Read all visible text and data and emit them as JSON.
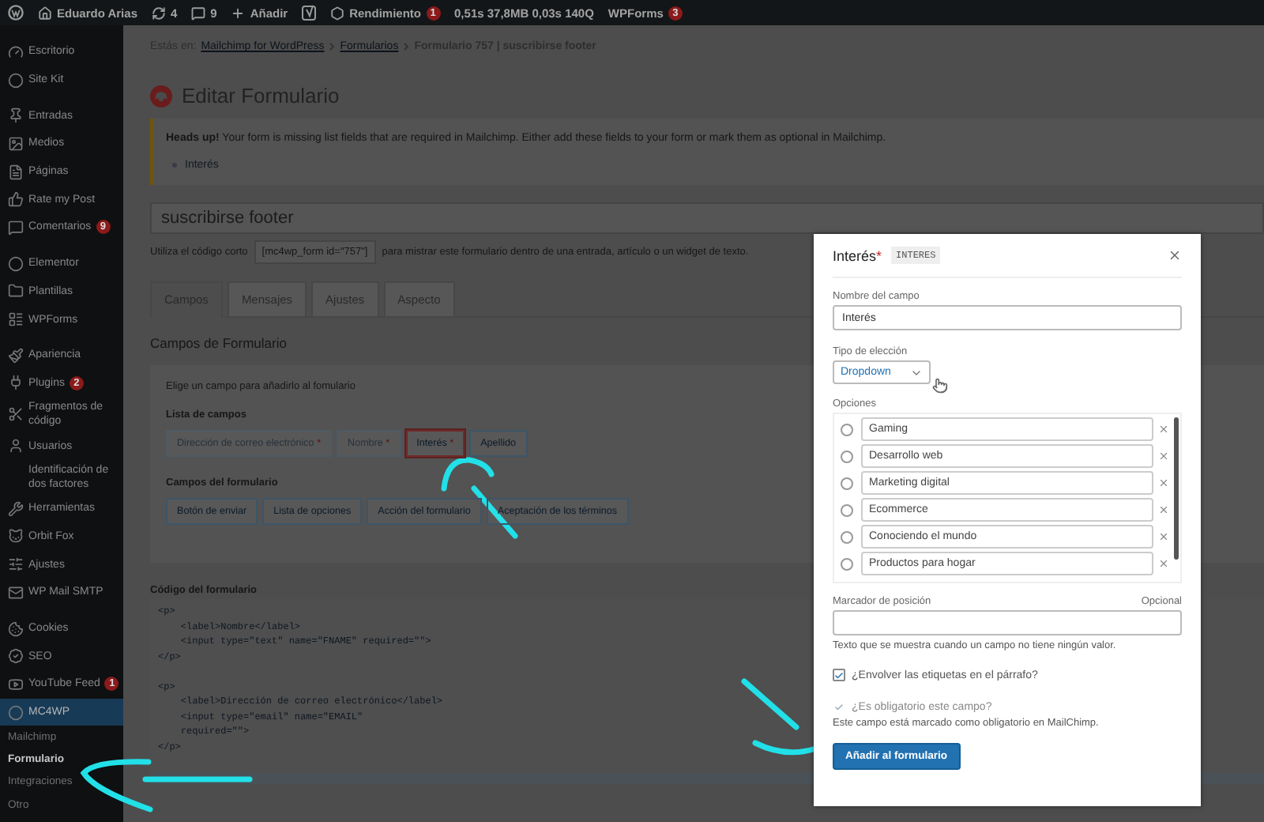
{
  "admin_bar": {
    "items": [
      {
        "kind": "wp"
      },
      {
        "kind": "home",
        "label": "Eduardo Arias"
      },
      {
        "kind": "updates",
        "label": "4"
      },
      {
        "kind": "comments",
        "label": "9"
      },
      {
        "kind": "new",
        "label": "Añadir"
      },
      {
        "kind": "yoast"
      },
      {
        "kind": "performance",
        "label": "Rendimiento",
        "badge": "1"
      },
      {
        "kind": "text",
        "label": "0,51s 37,8MB 0,03s 140Q"
      },
      {
        "kind": "text",
        "label": "WPForms",
        "badge": "3"
      }
    ]
  },
  "sidebar": {
    "groups": [
      {
        "items": [
          {
            "label": "Escritorio",
            "selected": false
          },
          {
            "label": "Site Kit",
            "selected": false
          }
        ]
      },
      {
        "items": [
          {
            "label": "Entradas",
            "selected": false
          },
          {
            "label": "Medios",
            "selected": false
          },
          {
            "label": "Páginas",
            "selected": false
          },
          {
            "label": "Rate my Post",
            "selected": false
          },
          {
            "label": "Comentarios",
            "badge": "9",
            "selected": false
          }
        ]
      },
      {
        "items": [
          {
            "label": "Elementor",
            "selected": false
          },
          {
            "label": "Plantillas",
            "selected": false
          },
          {
            "label": "WPForms",
            "selected": false
          }
        ]
      },
      {
        "items": [
          {
            "label": "Apariencia",
            "selected": false
          },
          {
            "label": "Plugins",
            "badge": "2",
            "selected": false
          },
          {
            "label": "Fragmentos de código",
            "selected": false
          },
          {
            "label": "Usuarios",
            "selected": false
          },
          {
            "label": "Identificación de dos factores",
            "selected": false
          },
          {
            "label": "Herramientas",
            "selected": false
          },
          {
            "label": "Orbit Fox",
            "selected": false
          },
          {
            "label": "Ajustes",
            "selected": false
          },
          {
            "label": "WP Mail SMTP",
            "selected": false
          }
        ]
      },
      {
        "items": [
          {
            "label": "Cookies",
            "selected": false
          },
          {
            "label": "SEO",
            "selected": false
          },
          {
            "label": "YouTube Feed",
            "badge": "1",
            "selected": false
          },
          {
            "label": "MC4WP",
            "selected": true,
            "children": [
              {
                "label": "Mailchimp",
                "selected": false
              },
              {
                "label": "Formulario",
                "selected": true
              },
              {
                "label": "Integraciones",
                "selected": false
              },
              {
                "label": "Otro",
                "selected": false
              }
            ]
          }
        ]
      }
    ]
  },
  "breadcrumb": {
    "prefix": "Estás en:",
    "links": [
      "Mailchimp for WordPress",
      "Formularios"
    ],
    "current": "Formulario 757 | suscribirse footer"
  },
  "page_title": "Editar Formulario",
  "notice": {
    "text": "**Heads up!** Your form is missing list fields that are required in Mailchimp. Either add these fields to your form or mark them as optional in Mailchimp.",
    "items": [
      "Interés"
    ]
  },
  "form_title": "suscribirse footer",
  "shortcode": {
    "before": "Utiliza el código corto",
    "code": "[mc4wp_form id=\"757\"]",
    "after": "para mistrar este formulario dentro de una entrada, artículo o un widget de texto."
  },
  "tabs": [
    {
      "label": "Campos",
      "selected": true
    },
    {
      "label": "Mensajes",
      "selected": false
    },
    {
      "label": "Ajustes",
      "selected": false
    },
    {
      "label": "Aspecto",
      "selected": false
    }
  ],
  "section_title": "Campos de Formulario",
  "field_chooser": {
    "intro": "Elige un campo para añadirlo al fomulario",
    "list_title": "Lista de campos",
    "list_fields": [
      {
        "label": "Dirección de correo electrónico",
        "marker": "*",
        "disabled": true,
        "selected": false
      },
      {
        "label": "Nombre",
        "marker": "*",
        "disabled": true,
        "selected": false
      },
      {
        "label": "Interés",
        "marker": "*",
        "disabled": false,
        "selected": true
      },
      {
        "label": "Apellido",
        "disabled": false,
        "selected": false
      }
    ],
    "form_title": "Campos del formulario",
    "form_fields": [
      "Botón de enviar",
      "Lista de opciones",
      "Acción del formulario",
      "Aceptación de los términos"
    ]
  },
  "code": {
    "title": "Código del formulario",
    "blocks": [
      [
        "<p>",
        "    <label>Nombre</label>",
        "    <input type=\"text\" name=\"FNAME\" required=\"\">",
        "</p>"
      ],
      [
        "<p>",
        "    <label>Dirección de correo electrónico</label>",
        "    <input type=\"email\" name=\"EMAIL\"",
        "    required=\"\">",
        "</p>"
      ]
    ]
  },
  "modal": {
    "title": "Interés",
    "marker": "*",
    "tag": "INTERES",
    "name_label": "Nombre del campo",
    "name_value": "Interés",
    "type_label": "Tipo de elección",
    "type_value": "Dropdown",
    "options_label": "Opciones",
    "options": [
      {
        "label": "Gaming",
        "selected": false
      },
      {
        "label": "Desarrollo web",
        "selected": false
      },
      {
        "label": "Marketing digital",
        "selected": false
      },
      {
        "label": "Ecommerce",
        "selected": false
      },
      {
        "label": "Conociendo el mundo",
        "selected": false
      },
      {
        "label": "Productos para hogar",
        "selected": false
      }
    ],
    "placeholder_label": "Marcador de posición",
    "placeholder_optional": "Opcional",
    "placeholder_help": "Texto que se muestra cuando un campo no tiene ningún valor.",
    "checks": [
      {
        "label": "¿Envolver las etiquetas en el párrafo?",
        "checked": true,
        "disabled": false
      },
      {
        "label": "¿Es obligatorio este campo?",
        "checked": true,
        "disabled": true
      }
    ],
    "required_note": "Este campo está marcado como obligatorio en MailChimp.",
    "submit": "Añadir al formulario"
  }
}
